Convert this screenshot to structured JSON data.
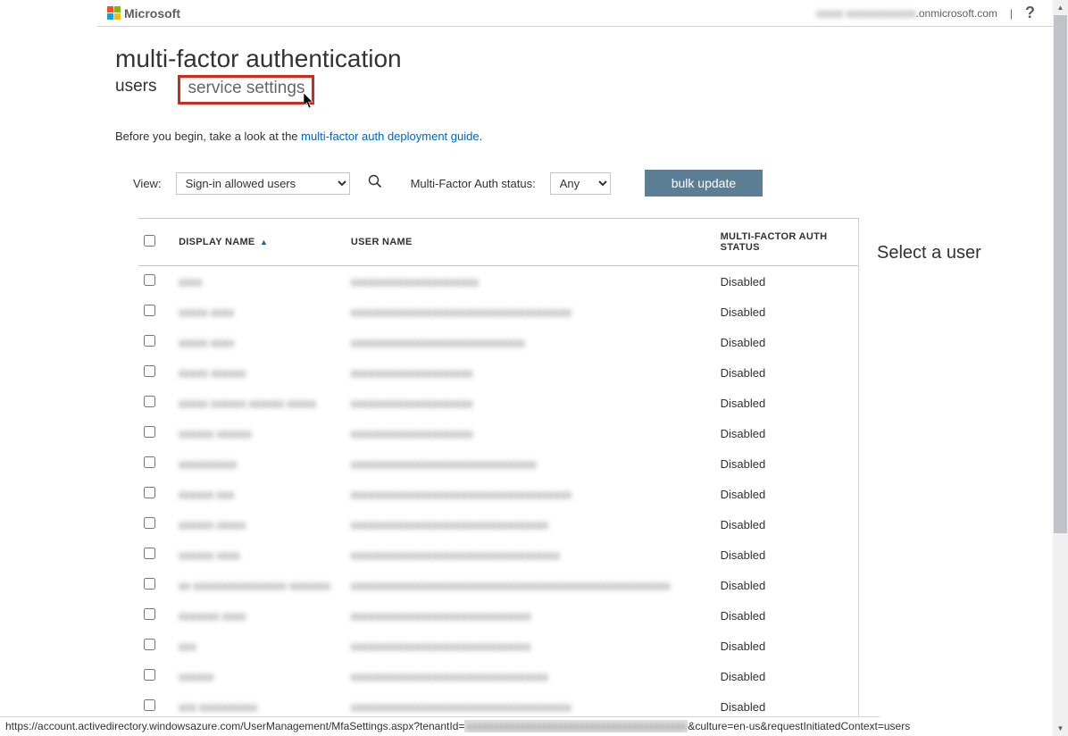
{
  "header": {
    "brand": "Microsoft",
    "account_suffix": ".onmicrosoft.com",
    "help_glyph": "?"
  },
  "page": {
    "title": "multi-factor authentication",
    "tabs": {
      "users": "users",
      "service_settings": "service settings"
    },
    "intro_prefix": "Before you begin, take a look at the ",
    "intro_link": "multi-factor auth deployment guide",
    "intro_suffix": "."
  },
  "filters": {
    "view_label": "View:",
    "view_value": "Sign-in allowed users",
    "status_label": "Multi-Factor Auth status:",
    "status_value": "Any",
    "bulk_button": "bulk update"
  },
  "table": {
    "headers": {
      "display_name": "DISPLAY NAME",
      "user_name": "USER NAME",
      "mfa_status": "MULTI-FACTOR AUTH STATUS"
    },
    "rows": [
      {
        "status": "Disabled"
      },
      {
        "status": "Disabled"
      },
      {
        "status": "Disabled"
      },
      {
        "status": "Disabled"
      },
      {
        "status": "Disabled"
      },
      {
        "status": "Disabled"
      },
      {
        "status": "Disabled"
      },
      {
        "status": "Disabled"
      },
      {
        "status": "Disabled"
      },
      {
        "status": "Disabled"
      },
      {
        "status": "Disabled"
      },
      {
        "status": "Disabled"
      },
      {
        "status": "Disabled"
      },
      {
        "status": "Disabled"
      },
      {
        "status": "Disabled"
      }
    ]
  },
  "side_panel": {
    "title": "Select a user"
  },
  "statusbar": {
    "prefix": "https://account.activedirectory.windowsazure.com/UserManagement/MfaSettings.aspx?tenantId=",
    "suffix": "&culture=en-us&requestInitiatedContext=users"
  }
}
